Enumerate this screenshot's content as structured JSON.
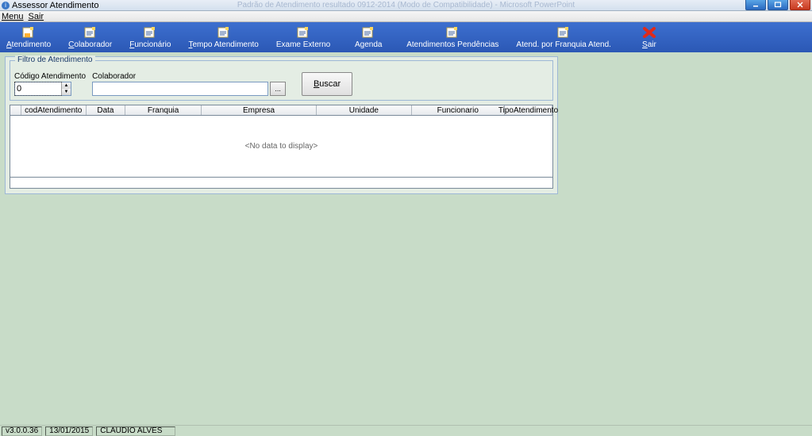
{
  "window": {
    "title": "Assessor Atendimento",
    "bg_title": "Padrão de Atendimento resultado 0912-2014 (Modo de Compatibilidade) - Microsoft PowerPoint"
  },
  "menu": {
    "items": [
      "Menu",
      "Sair"
    ]
  },
  "toolbar": {
    "items": [
      {
        "label": "Atendimento",
        "u": "A"
      },
      {
        "label": "Colaborador",
        "u": "C"
      },
      {
        "label": "Funcionário",
        "u": "F"
      },
      {
        "label": "Tempo Atendimento",
        "u": "T"
      },
      {
        "label": "Exame Externo",
        "u": ""
      },
      {
        "label": "Agenda",
        "u": "g"
      },
      {
        "label": "Atendimentos Pendências",
        "u": ""
      },
      {
        "label": "Atend. por Franquia Atend.",
        "u": ""
      },
      {
        "label": "Sair",
        "u": "S"
      }
    ]
  },
  "filter": {
    "legend": "Filtro de Atendimento",
    "codigo_label": "Código Atendimento",
    "codigo_value": "0",
    "colaborador_label": "Colaborador",
    "colaborador_value": "",
    "ellipsis": "...",
    "buscar": "Buscar",
    "buscar_u": "B"
  },
  "grid": {
    "cols": [
      "",
      "codAtendimento",
      "Data",
      "Franquia",
      "Empresa",
      "Unidade",
      "Funcionario",
      "TipoAtendimento"
    ],
    "empty": "<No data to display>"
  },
  "status": {
    "version": "v3.0.0.36",
    "date": "13/01/2015",
    "user": "CLAUDIO ALVES"
  },
  "icons": {
    "doc_colors": {
      "page": "#fff",
      "corner": "#ffd860",
      "shadow": "#c8b070"
    },
    "exit_color": "#e02a1a"
  }
}
